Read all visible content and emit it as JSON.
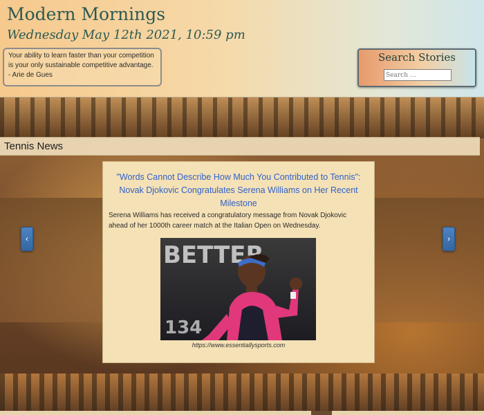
{
  "header": {
    "site_title": "Modern Mornings",
    "datetime": "Wednesday May 12th 2021, 10:59 pm",
    "quote": "Your ability to learn faster than your competition is your only sustainable competitive advantage. - Arie de Gues"
  },
  "search": {
    "title": "Search Stories",
    "placeholder": "Search …",
    "value": ""
  },
  "section": {
    "title": "Tennis News"
  },
  "carousel": {
    "prev_icon": "chevron-left-icon",
    "next_icon": "chevron-right-icon",
    "prev_glyph": "‹",
    "next_glyph": "›",
    "article": {
      "headline": "\"Words Cannot Describe How Much You Contributed to Tennis\": Novak Djokovic Congratulates Serena Williams on Her Recent Milestone",
      "summary": "Serena Williams has received a congratulatory message from Novak Djokovic ahead of her 1000th career match at the Italian Open on Wednesday.",
      "image_credit": "https://www.essentiallysports.com",
      "photo_banner_text": "BETTER",
      "photo_number_text": "134"
    }
  },
  "colors": {
    "title": "#2c5a52",
    "link": "#2f62c9",
    "arrow": "#3f76b8",
    "card": "#f5e1b6"
  }
}
